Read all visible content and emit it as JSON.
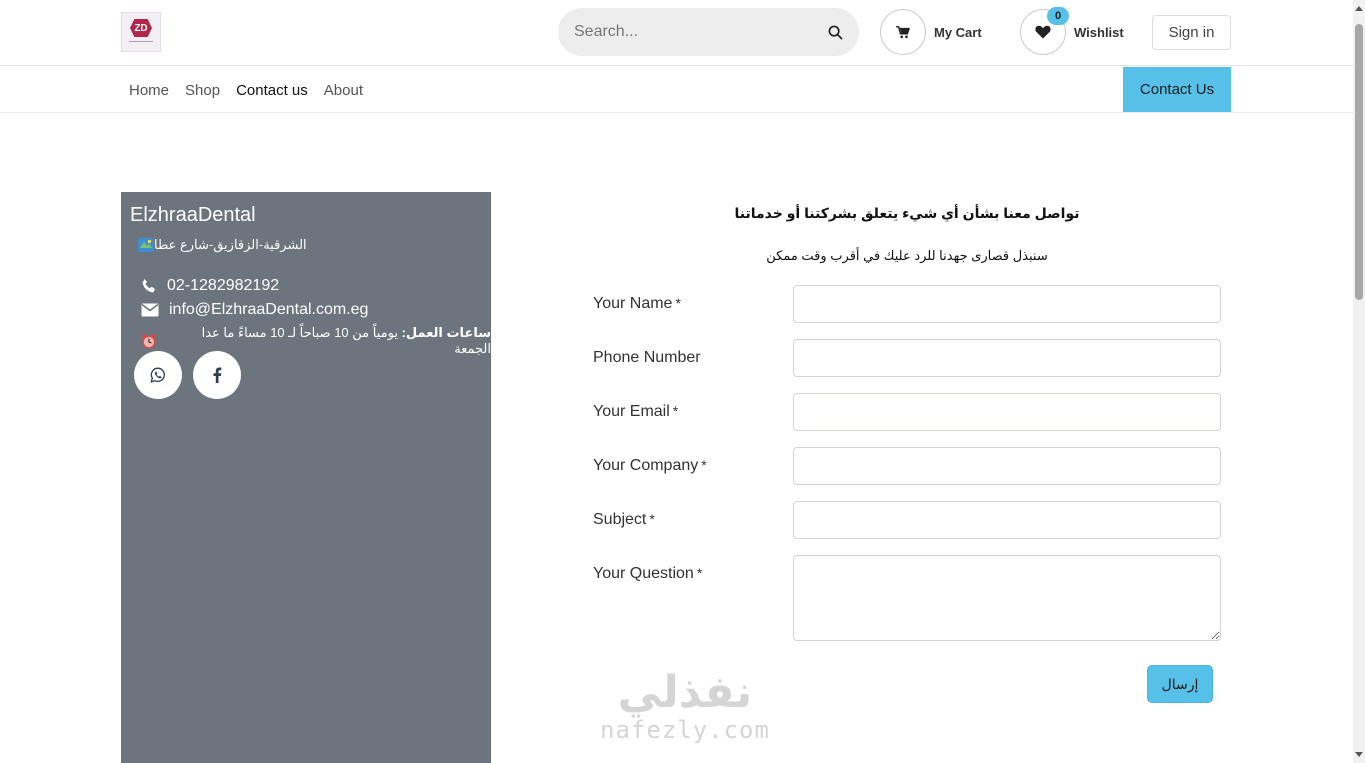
{
  "header": {
    "logo_text": "ZD",
    "search_placeholder": "Search...",
    "cart_label": "My Cart",
    "wishlist_label": "Wishlist",
    "wishlist_count": "0",
    "signin_label": "Sign in"
  },
  "nav": {
    "items": [
      {
        "label": "Home"
      },
      {
        "label": "Shop"
      },
      {
        "label": "Contact us"
      },
      {
        "label": "About"
      }
    ],
    "cta_label": "Contact Us"
  },
  "info": {
    "company": "ElzhraaDental",
    "address": "الشرقية-الزقازيق-شارع عطا",
    "phone": "02-1282982192",
    "email": "info@ElzhraaDental.com.eg",
    "hours_label": "ساعات العمل:",
    "hours_value": " يومياً من 10 صباحاً لـ 10 مساءً ما عدا الجمعة"
  },
  "form": {
    "title": "تواصل معنا بشأن أي شيء يتعلق بشركتنا أو خدماتنا",
    "subtitle": "سنبذل قصارى جهدنا للرد عليك في أقرب وقت ممكن",
    "fields": [
      {
        "label": "Your Name",
        "required": "*"
      },
      {
        "label": "Phone Number",
        "required": ""
      },
      {
        "label": "Your Email",
        "required": "*"
      },
      {
        "label": "Your Company",
        "required": "*"
      },
      {
        "label": "Subject",
        "required": "*"
      },
      {
        "label": "Your Question",
        "required": "*"
      }
    ],
    "submit_label": "إرسال"
  },
  "watermark": {
    "arabic": "نفذلي",
    "latin": "nafezly.com"
  },
  "colors": {
    "accent": "#56c0e8",
    "panel": "#6c757d"
  }
}
